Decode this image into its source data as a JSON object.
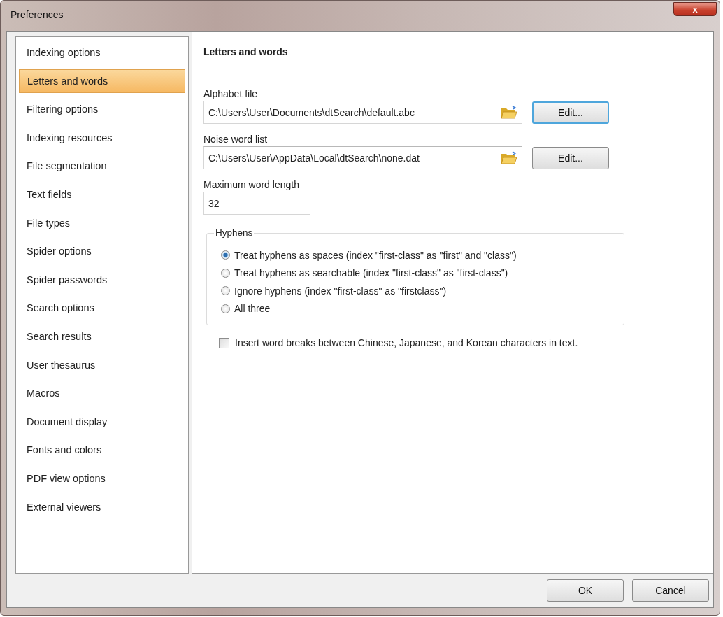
{
  "window": {
    "title": "Preferences",
    "close_label": "x"
  },
  "sidebar": {
    "items": [
      {
        "label": "Indexing options",
        "selected": false
      },
      {
        "label": "Letters and words",
        "selected": true
      },
      {
        "label": "Filtering options",
        "selected": false
      },
      {
        "label": "Indexing resources",
        "selected": false
      },
      {
        "label": "File segmentation",
        "selected": false
      },
      {
        "label": "Text fields",
        "selected": false
      },
      {
        "label": "File types",
        "selected": false
      },
      {
        "label": "Spider options",
        "selected": false
      },
      {
        "label": "Spider passwords",
        "selected": false
      },
      {
        "label": "Search options",
        "selected": false
      },
      {
        "label": "Search results",
        "selected": false
      },
      {
        "label": "User thesaurus",
        "selected": false
      },
      {
        "label": "Macros",
        "selected": false
      },
      {
        "label": "Document display",
        "selected": false
      },
      {
        "label": "Fonts and colors",
        "selected": false
      },
      {
        "label": "PDF view options",
        "selected": false
      },
      {
        "label": "External viewers",
        "selected": false
      }
    ]
  },
  "panel": {
    "heading": "Letters and words",
    "files": [
      {
        "label": "Alphabet file",
        "value": "C:\\Users\\User\\Documents\\dtSearch\\default.abc",
        "button": "Edit...",
        "focused": true
      },
      {
        "label": "Noise word list",
        "value": "C:\\Users\\User\\AppData\\Local\\dtSearch\\none.dat",
        "button": "Edit...",
        "focused": false
      }
    ],
    "max_length": {
      "label": "Maximum word length",
      "value": "32"
    },
    "hyphens": {
      "legend": "Hyphens",
      "options": [
        {
          "label": "Treat hyphens as spaces (index \"first-class\" as \"first\" and \"class\")",
          "selected": true
        },
        {
          "label": "Treat hyphens as searchable (index \"first-class\" as \"first-class\")",
          "selected": false
        },
        {
          "label": "Ignore hyphens (index \"first-class\" as \"firstclass\")",
          "selected": false
        },
        {
          "label": "All three",
          "selected": false
        }
      ]
    },
    "cjk": {
      "label": "Insert word breaks between Chinese, Japanese, and Korean characters in text.",
      "checked": false
    }
  },
  "buttons": [
    "OK",
    "Cancel"
  ]
}
